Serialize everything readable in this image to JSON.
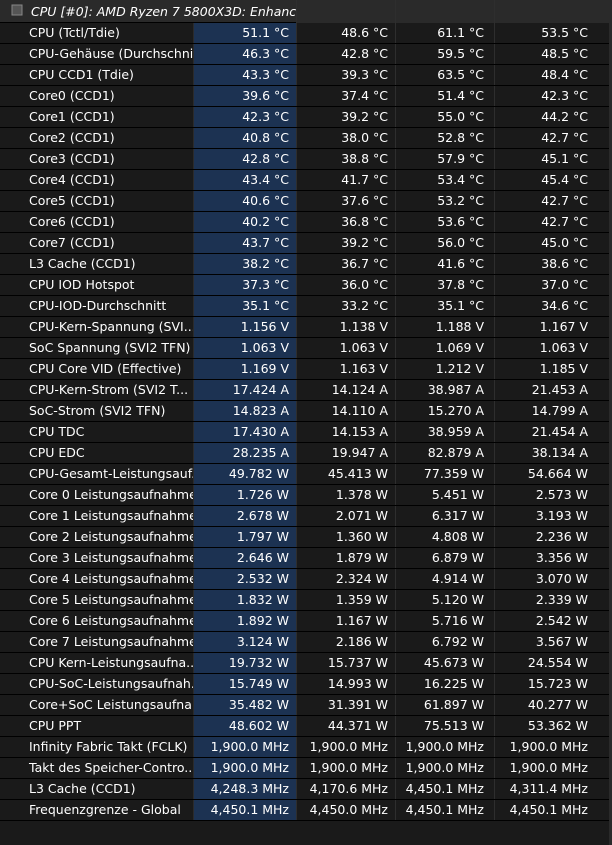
{
  "group_header": "CPU [#0]: AMD Ryzen 7 5800X3D: Enhanced",
  "rows": [
    {
      "icon": "thermometer-icon",
      "name": "CPU (Tctl/Tdie)",
      "current": "51.1 °C",
      "min": "48.6 °C",
      "max": "61.1 °C",
      "avg": "53.5 °C"
    },
    {
      "icon": "thermometer-icon",
      "name": "CPU-Gehäuse (Durchschni...",
      "current": "46.3 °C",
      "min": "42.8 °C",
      "max": "59.5 °C",
      "avg": "48.5 °C"
    },
    {
      "icon": "thermometer-icon",
      "name": "CPU CCD1 (Tdie)",
      "current": "43.3 °C",
      "min": "39.3 °C",
      "max": "63.5 °C",
      "avg": "48.4 °C"
    },
    {
      "icon": "thermometer-icon",
      "name": "Core0 (CCD1)",
      "current": "39.6 °C",
      "min": "37.4 °C",
      "max": "51.4 °C",
      "avg": "42.3 °C"
    },
    {
      "icon": "thermometer-icon",
      "name": "Core1 (CCD1)",
      "current": "42.3 °C",
      "min": "39.2 °C",
      "max": "55.0 °C",
      "avg": "44.2 °C"
    },
    {
      "icon": "thermometer-icon",
      "name": "Core2 (CCD1)",
      "current": "40.8 °C",
      "min": "38.0 °C",
      "max": "52.8 °C",
      "avg": "42.7 °C"
    },
    {
      "icon": "thermometer-icon",
      "name": "Core3 (CCD1)",
      "current": "42.8 °C",
      "min": "38.8 °C",
      "max": "57.9 °C",
      "avg": "45.1 °C"
    },
    {
      "icon": "thermometer-icon",
      "name": "Core4 (CCD1)",
      "current": "43.4 °C",
      "min": "41.7 °C",
      "max": "53.4 °C",
      "avg": "45.4 °C"
    },
    {
      "icon": "thermometer-icon",
      "name": "Core5 (CCD1)",
      "current": "40.6 °C",
      "min": "37.6 °C",
      "max": "53.2 °C",
      "avg": "42.7 °C"
    },
    {
      "icon": "thermometer-icon",
      "name": "Core6 (CCD1)",
      "current": "40.2 °C",
      "min": "36.8 °C",
      "max": "53.6 °C",
      "avg": "42.7 °C"
    },
    {
      "icon": "thermometer-icon",
      "name": "Core7 (CCD1)",
      "current": "43.7 °C",
      "min": "39.2 °C",
      "max": "56.0 °C",
      "avg": "45.0 °C"
    },
    {
      "icon": "thermometer-icon",
      "name": "L3 Cache (CCD1)",
      "current": "38.2 °C",
      "min": "36.7 °C",
      "max": "41.6 °C",
      "avg": "38.6 °C"
    },
    {
      "icon": "thermometer-icon",
      "name": "CPU IOD Hotspot",
      "current": "37.3 °C",
      "min": "36.0 °C",
      "max": "37.8 °C",
      "avg": "37.0 °C"
    },
    {
      "icon": "thermometer-icon",
      "name": "CPU-IOD-Durchschnitt",
      "current": "35.1 °C",
      "min": "33.2 °C",
      "max": "35.1 °C",
      "avg": "34.6 °C"
    },
    {
      "icon": "lightning-icon",
      "name": "CPU-Kern-Spannung (SVI...",
      "current": "1.156 V",
      "min": "1.138 V",
      "max": "1.188 V",
      "avg": "1.167 V"
    },
    {
      "icon": "lightning-icon",
      "name": "SoC Spannung (SVI2 TFN)",
      "current": "1.063 V",
      "min": "1.063 V",
      "max": "1.069 V",
      "avg": "1.063 V"
    },
    {
      "icon": "lightning-icon",
      "name": "CPU Core VID (Effective)",
      "current": "1.169 V",
      "min": "1.163 V",
      "max": "1.212 V",
      "avg": "1.185 V"
    },
    {
      "icon": "lightning-icon",
      "name": "CPU-Kern-Strom (SVI2 T...",
      "current": "17.424 A",
      "min": "14.124 A",
      "max": "38.987 A",
      "avg": "21.453 A"
    },
    {
      "icon": "lightning-icon",
      "name": "SoC-Strom (SVI2 TFN)",
      "current": "14.823 A",
      "min": "14.110 A",
      "max": "15.270 A",
      "avg": "14.799 A"
    },
    {
      "icon": "lightning-icon",
      "name": "CPU TDC",
      "current": "17.430 A",
      "min": "14.153 A",
      "max": "38.959 A",
      "avg": "21.454 A"
    },
    {
      "icon": "lightning-icon",
      "name": "CPU EDC",
      "current": "28.235 A",
      "min": "19.947 A",
      "max": "82.879 A",
      "avg": "38.134 A"
    },
    {
      "icon": "lightning-icon",
      "name": "CPU-Gesamt-Leistungsauf...",
      "current": "49.782 W",
      "min": "45.413 W",
      "max": "77.359 W",
      "avg": "54.664 W"
    },
    {
      "icon": "lightning-icon",
      "name": "Core 0 Leistungsaufnahme",
      "current": "1.726 W",
      "min": "1.378 W",
      "max": "5.451 W",
      "avg": "2.573 W"
    },
    {
      "icon": "lightning-icon",
      "name": "Core 1 Leistungsaufnahme",
      "current": "2.678 W",
      "min": "2.071 W",
      "max": "6.317 W",
      "avg": "3.193 W"
    },
    {
      "icon": "lightning-icon",
      "name": "Core 2 Leistungsaufnahme",
      "current": "1.797 W",
      "min": "1.360 W",
      "max": "4.808 W",
      "avg": "2.236 W"
    },
    {
      "icon": "lightning-icon",
      "name": "Core 3 Leistungsaufnahme",
      "current": "2.646 W",
      "min": "1.879 W",
      "max": "6.879 W",
      "avg": "3.356 W"
    },
    {
      "icon": "lightning-icon",
      "name": "Core 4 Leistungsaufnahme",
      "current": "2.532 W",
      "min": "2.324 W",
      "max": "4.914 W",
      "avg": "3.070 W"
    },
    {
      "icon": "lightning-icon",
      "name": "Core 5 Leistungsaufnahme",
      "current": "1.832 W",
      "min": "1.359 W",
      "max": "5.120 W",
      "avg": "2.339 W"
    },
    {
      "icon": "lightning-icon",
      "name": "Core 6 Leistungsaufnahme",
      "current": "1.892 W",
      "min": "1.167 W",
      "max": "5.716 W",
      "avg": "2.542 W"
    },
    {
      "icon": "lightning-icon",
      "name": "Core 7 Leistungsaufnahme",
      "current": "3.124 W",
      "min": "2.186 W",
      "max": "6.792 W",
      "avg": "3.567 W"
    },
    {
      "icon": "lightning-icon",
      "name": "CPU Kern-Leistungsaufna...",
      "current": "19.732 W",
      "min": "15.737 W",
      "max": "45.673 W",
      "avg": "24.554 W"
    },
    {
      "icon": "lightning-icon",
      "name": "CPU-SoC-Leistungsaufnah...",
      "current": "15.749 W",
      "min": "14.993 W",
      "max": "16.225 W",
      "avg": "15.723 W"
    },
    {
      "icon": "lightning-icon",
      "name": "Core+SoC Leistungsaufna...",
      "current": "35.482 W",
      "min": "31.391 W",
      "max": "61.897 W",
      "avg": "40.277 W"
    },
    {
      "icon": "lightning-icon",
      "name": "CPU PPT",
      "current": "48.602 W",
      "min": "44.371 W",
      "max": "75.513 W",
      "avg": "53.362 W"
    },
    {
      "icon": "clock-icon",
      "name": "Infinity Fabric Takt (FCLK)",
      "current": "1,900.0 MHz",
      "min": "1,900.0 MHz",
      "max": "1,900.0 MHz",
      "avg": "1,900.0 MHz"
    },
    {
      "icon": "clock-icon",
      "name": "Takt des Speicher-Contro...",
      "current": "1,900.0 MHz",
      "min": "1,900.0 MHz",
      "max": "1,900.0 MHz",
      "avg": "1,900.0 MHz"
    },
    {
      "icon": "clock-icon",
      "name": "L3 Cache (CCD1)",
      "current": "4,248.3 MHz",
      "min": "4,170.6 MHz",
      "max": "4,450.1 MHz",
      "avg": "4,311.4 MHz"
    },
    {
      "icon": "clock-icon",
      "name": "Frequenzgrenze - Global",
      "current": "4,450.1 MHz",
      "min": "4,450.0 MHz",
      "max": "4,450.1 MHz",
      "avg": "4,450.1 MHz"
    }
  ],
  "colors": {
    "current_col_bg": "#1c3252",
    "thermo_red": "#e03030",
    "bolt_yellow": "#f0b000",
    "clock_gray": "#c8c8c8"
  }
}
